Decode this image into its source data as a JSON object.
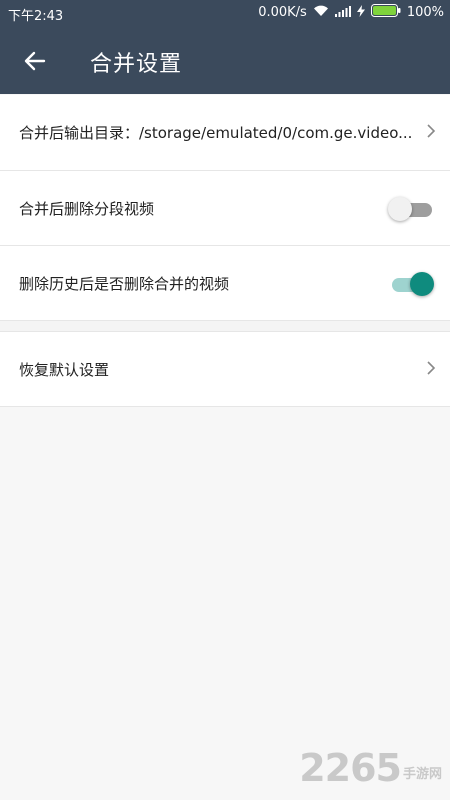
{
  "status_bar": {
    "time": "下午2:43",
    "speed": "0.00K/s",
    "battery": "100%"
  },
  "app_bar": {
    "title": "合并设置"
  },
  "settings": {
    "output_dir_label": "合并后输出目录：/storage/emulated/0/com.ge.video...",
    "delete_segments_label": "合并后删除分段视频",
    "delete_segments_on": false,
    "delete_merged_label": "删除历史后是否删除合并的视频",
    "delete_merged_on": true,
    "restore_defaults_label": "恢复默认设置"
  },
  "watermark": {
    "number": "2265",
    "site": "手游网"
  },
  "colors": {
    "appbar": "#3b4a5c",
    "accent": "#0f8b7e"
  }
}
